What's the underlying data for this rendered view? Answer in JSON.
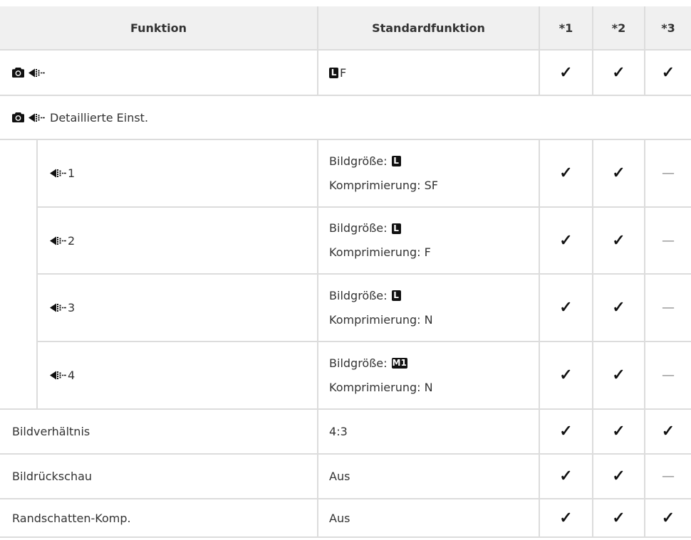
{
  "header": {
    "function": "Funktion",
    "default": "Standardfunktion",
    "cols": [
      "*1",
      "*2",
      "*3"
    ]
  },
  "rows": {
    "quality": {
      "icons": [
        "camera-icon",
        "image-quality-icon"
      ],
      "default_badge": "L",
      "default_text": "F",
      "marks": [
        "✓",
        "✓",
        "✓"
      ]
    },
    "detail": {
      "icons": [
        "camera-icon",
        "image-quality-icon"
      ],
      "label": "Detaillierte Einst."
    },
    "sub": [
      {
        "icon": "image-quality-icon",
        "num": "1",
        "size_label": "Bildgröße:",
        "size_badge": "L",
        "compression": "Komprimierung: SF",
        "marks": [
          "✓",
          "✓",
          "—"
        ]
      },
      {
        "icon": "image-quality-icon",
        "num": "2",
        "size_label": "Bildgröße:",
        "size_badge": "L",
        "compression": "Komprimierung: F",
        "marks": [
          "✓",
          "✓",
          "—"
        ]
      },
      {
        "icon": "image-quality-icon",
        "num": "3",
        "size_label": "Bildgröße:",
        "size_badge": "L",
        "compression": "Komprimierung: N",
        "marks": [
          "✓",
          "✓",
          "—"
        ]
      },
      {
        "icon": "image-quality-icon",
        "num": "4",
        "size_label": "Bildgröße:",
        "size_badge": "M1",
        "compression": "Komprimierung: N",
        "marks": [
          "✓",
          "✓",
          "—"
        ]
      }
    ],
    "simple": [
      {
        "label": "Bildverhältnis",
        "default": "4:3",
        "marks": [
          "✓",
          "✓",
          "✓"
        ]
      },
      {
        "label": "Bildrückschau",
        "default": "Aus",
        "marks": [
          "✓",
          "✓",
          "—"
        ]
      },
      {
        "label": "Randschatten-Komp.",
        "default": "Aus",
        "marks": [
          "✓",
          "✓",
          "✓"
        ]
      }
    ]
  },
  "colors": {
    "header_bg": "#f0f0f0",
    "grid": "#dcdcdc",
    "text": "#333333",
    "mark": "#111111",
    "dash": "#8a8a8a"
  }
}
